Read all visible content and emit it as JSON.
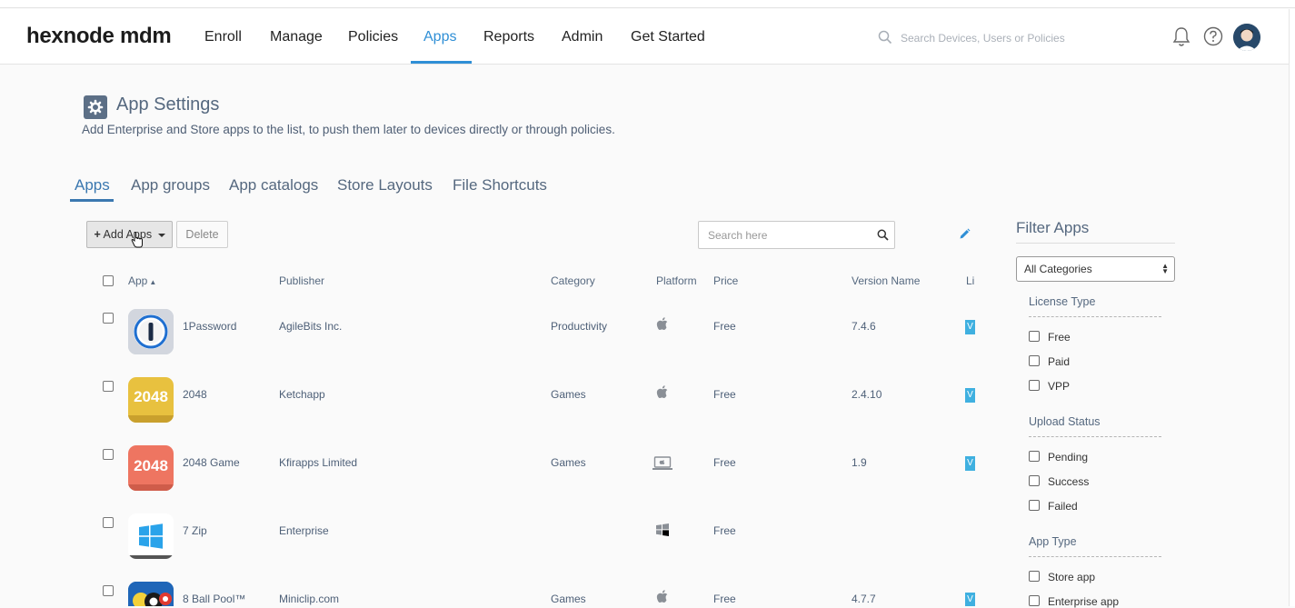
{
  "header": {
    "logo": "hexnode mdm",
    "nav": [
      "Enroll",
      "Manage",
      "Policies",
      "Apps",
      "Reports",
      "Admin",
      "Get Started"
    ],
    "active_nav": "Apps",
    "search_placeholder": "Search Devices, Users or Policies",
    "accent_color": "#2f8fd6"
  },
  "page": {
    "title": "App Settings",
    "subtitle": "Add Enterprise and Store apps to the list, to push them later to devices directly or through policies."
  },
  "tabs": [
    "Apps",
    "App groups",
    "App catalogs",
    "Store Layouts",
    "File Shortcuts"
  ],
  "active_tab": "Apps",
  "toolbar": {
    "add_label": "Add Apps",
    "delete_label": "Delete",
    "search_placeholder": "Search here"
  },
  "table": {
    "columns": {
      "app": "App",
      "publisher": "Publisher",
      "category": "Category",
      "platform": "Platform",
      "price": "Price",
      "version": "Version Name",
      "license": "Li"
    },
    "rows": [
      {
        "name": "1Password",
        "publisher": "AgileBits Inc.",
        "category": "Productivity",
        "platform": "apple-icon",
        "price": "Free",
        "version": "7.4.6",
        "badge": "V"
      },
      {
        "name": "2048",
        "publisher": "Ketchapp",
        "category": "Games",
        "platform": "apple-icon",
        "price": "Free",
        "version": "2.4.10",
        "badge": "V"
      },
      {
        "name": "2048 Game",
        "publisher": "Kfirapps Limited",
        "category": "Games",
        "platform": "mac-laptop-icon",
        "price": "Free",
        "version": "1.9",
        "badge": "V"
      },
      {
        "name": "7 Zip",
        "publisher": "Enterprise",
        "category": "",
        "platform": "windows-icon",
        "price": "Free",
        "version": "",
        "badge": ""
      },
      {
        "name": "8 Ball Pool™",
        "publisher": "Miniclip.com",
        "category": "Games",
        "platform": "apple-icon",
        "price": "Free",
        "version": "4.7.7",
        "badge": "V"
      }
    ],
    "icon_texts": {
      "game2048": "2048"
    }
  },
  "filter": {
    "title": "Filter Apps",
    "category_select": "All Categories",
    "sections": [
      {
        "title": "License Type",
        "options": [
          "Free",
          "Paid",
          "VPP"
        ]
      },
      {
        "title": "Upload Status",
        "options": [
          "Pending",
          "Success",
          "Failed"
        ]
      },
      {
        "title": "App Type",
        "options": [
          "Store app",
          "Enterprise app"
        ]
      }
    ]
  }
}
